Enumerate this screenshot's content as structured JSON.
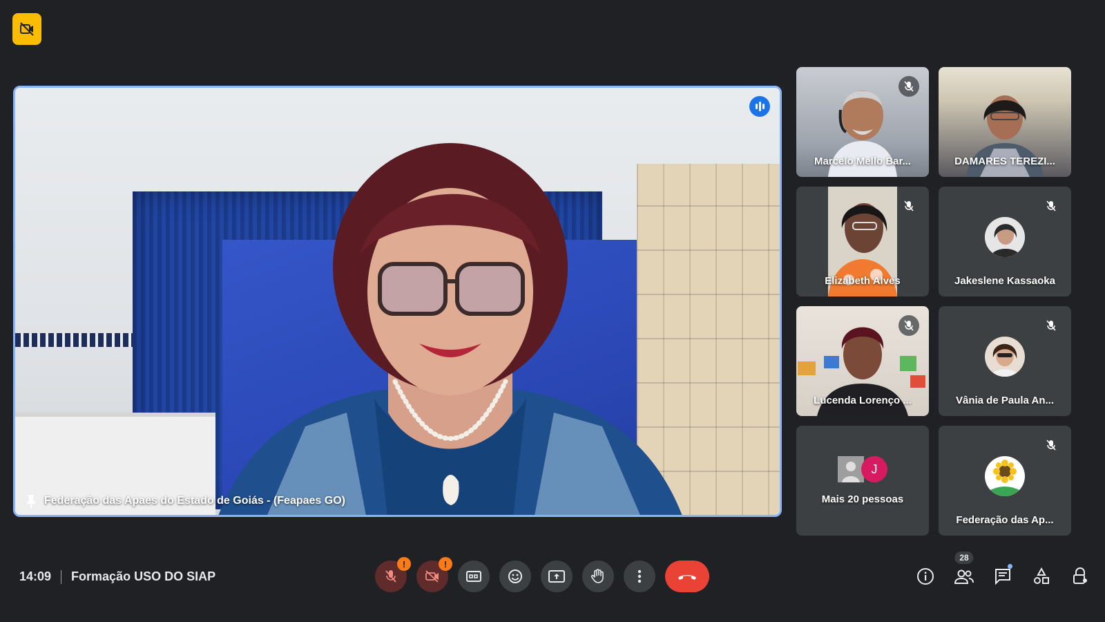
{
  "main": {
    "name": "Federação das Apaes do Estado de Goiás - (Feapaes GO)"
  },
  "tiles": [
    {
      "name": "Marcelo Mello Bar..."
    },
    {
      "name": "DAMARES TEREZI..."
    },
    {
      "name": "Elizabeth Alves"
    },
    {
      "name": "Jakeslene Kassaoka"
    },
    {
      "name": "Lucenda Lorenço ..."
    },
    {
      "name": "Vânia de Paula An..."
    },
    {
      "name": "Mais 20 pessoas",
      "avatar_letter": "J"
    },
    {
      "name": "Federação das Ap..."
    }
  ],
  "meeting": {
    "time": "14:09",
    "title": "Formação USO DO SIAP"
  },
  "controls": {
    "mic_warning": "!",
    "cam_warning": "!"
  },
  "people_count": "28",
  "colors": {
    "background": "#202124",
    "tile": "#3c4043",
    "active_border": "#8ab4f8",
    "hangup": "#ea4335",
    "recording": "#fbbc04",
    "warning": "#fa7b17"
  }
}
